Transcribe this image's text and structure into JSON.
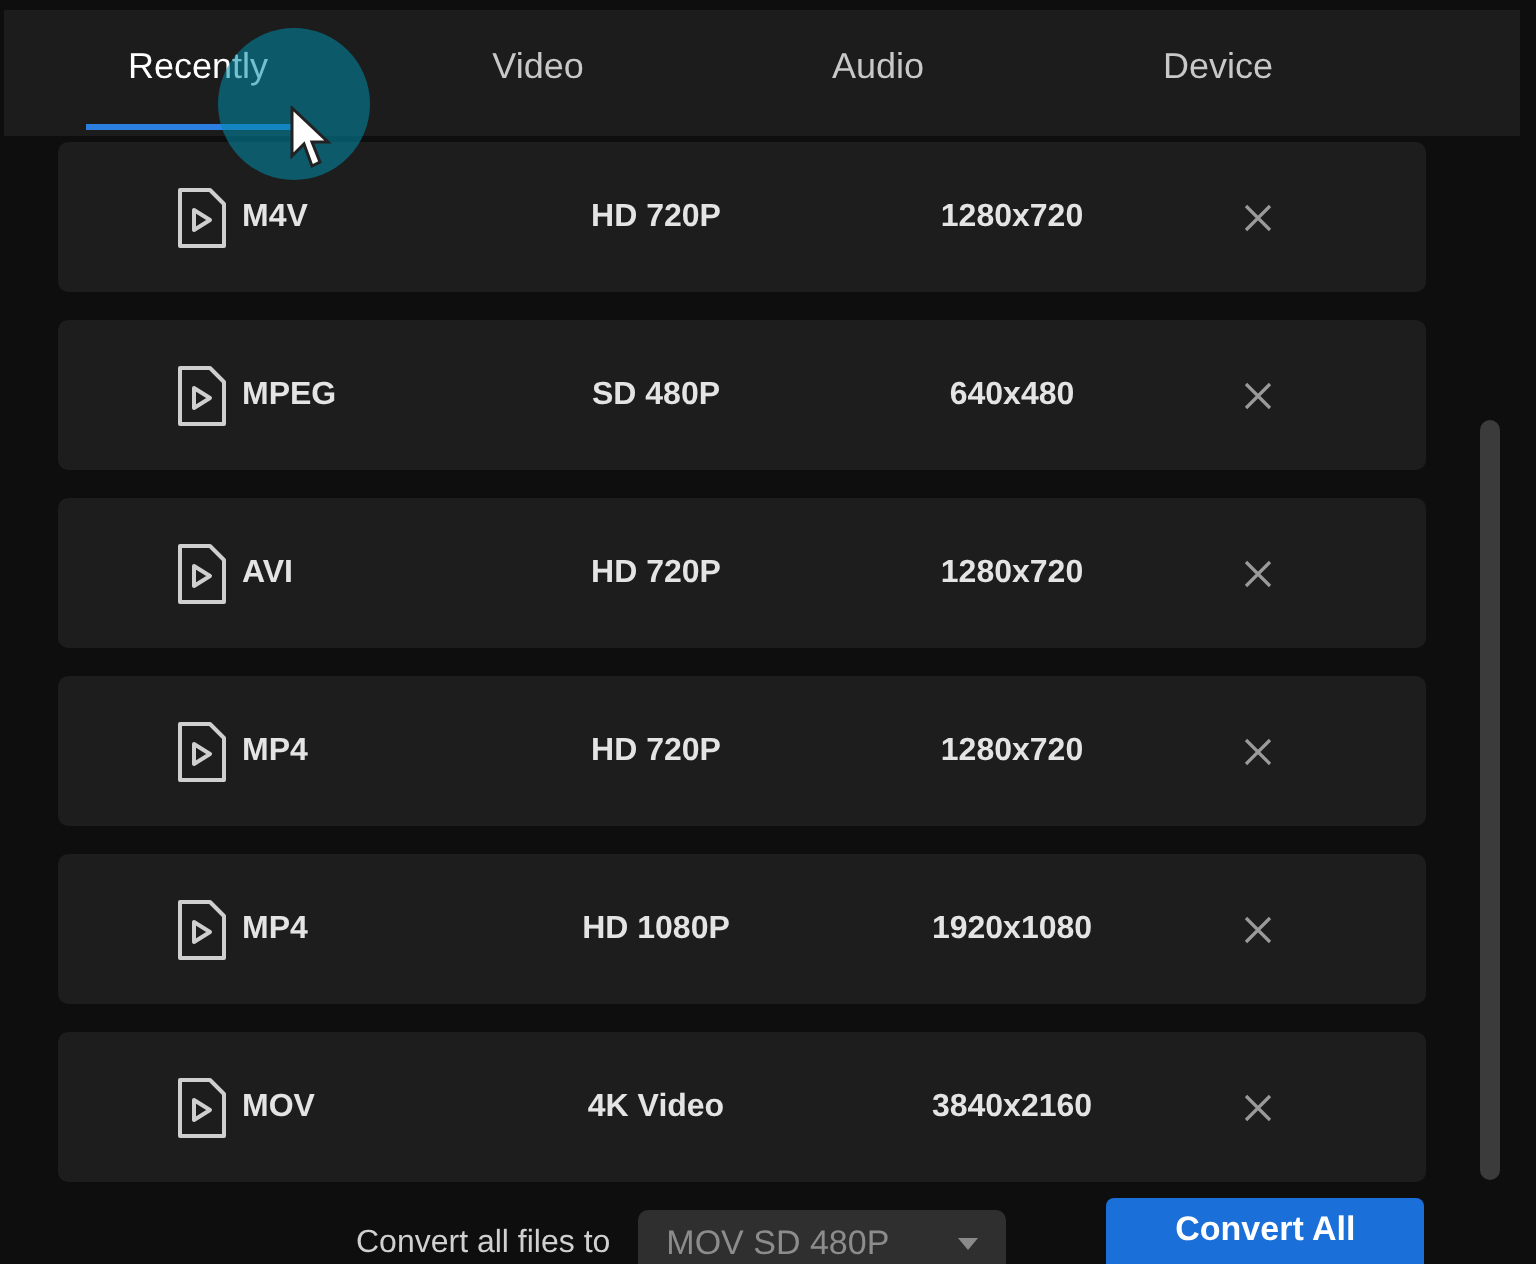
{
  "tabs": [
    {
      "label": "Recently",
      "selected": true
    },
    {
      "label": "Video",
      "selected": false
    },
    {
      "label": "Audio",
      "selected": false
    },
    {
      "label": "Device",
      "selected": false
    }
  ],
  "formats": [
    {
      "name": "M4V",
      "quality": "HD 720P",
      "resolution": "1280x720"
    },
    {
      "name": "MPEG",
      "quality": "SD 480P",
      "resolution": "640x480"
    },
    {
      "name": "AVI",
      "quality": "HD 720P",
      "resolution": "1280x720"
    },
    {
      "name": "MP4",
      "quality": "HD 720P",
      "resolution": "1280x720"
    },
    {
      "name": "MP4",
      "quality": "HD 1080P",
      "resolution": "1920x1080"
    },
    {
      "name": "MOV",
      "quality": "4K Video",
      "resolution": "3840x2160"
    }
  ],
  "footer": {
    "label": "Convert all files to",
    "format_value": "MOV SD 480P",
    "button": "Convert All"
  }
}
